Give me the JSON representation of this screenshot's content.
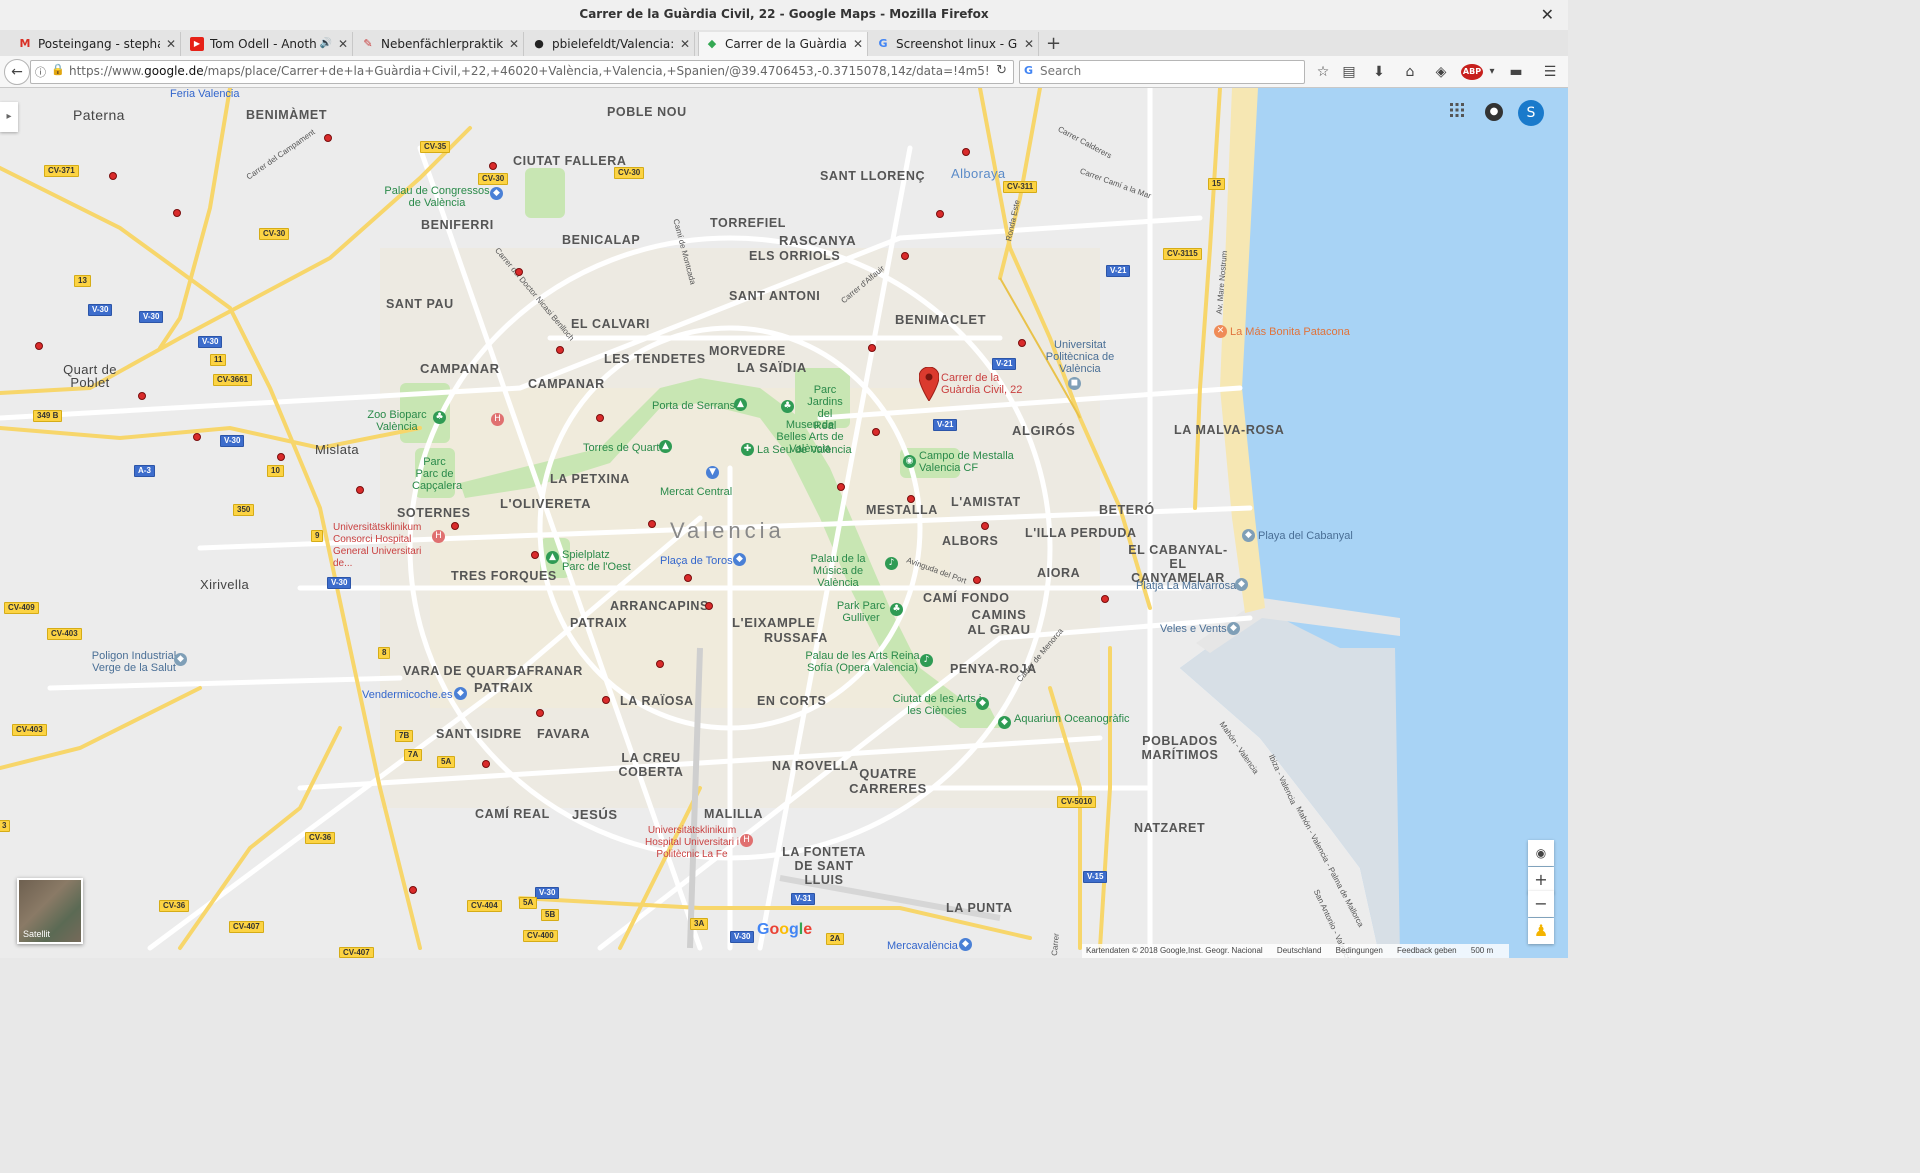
{
  "window": {
    "title": "Carrer de la Guàrdia Civil, 22 - Google Maps - Mozilla Firefox",
    "close_glyph": "✕"
  },
  "tabs": [
    {
      "label": "Posteingang - stepha...",
      "icon": "gmail-icon",
      "glyph": "M",
      "color": "#d93025",
      "close": "✕"
    },
    {
      "label": "Tom Odell - Anoth...",
      "icon": "youtube-icon",
      "glyph": "▶",
      "color": "#e62117",
      "close": "✕",
      "audio": "🔊"
    },
    {
      "label": "Nebenfächlerpraktiku...",
      "icon": "feather-icon",
      "glyph": "✎",
      "color": "#c94040",
      "close": "✕"
    },
    {
      "label": "pbielefeldt/Valencia: ...",
      "icon": "github-icon",
      "glyph": "●",
      "color": "#222222",
      "close": "✕"
    },
    {
      "label": "Carrer de la Guàrdia C...",
      "icon": "google-maps-icon",
      "glyph": "◆",
      "color": "#34a853",
      "close": "✕",
      "active": true
    },
    {
      "label": "Screenshot linux - Go...",
      "icon": "google-icon",
      "glyph": "G",
      "color": "#4285f4",
      "close": "✕"
    }
  ],
  "newtab": "+",
  "nav": {
    "back": "←",
    "url_prefix": "https://www.",
    "url_host": "google.de",
    "url_rest": "/maps/place/Carrer+de+la+Guàrdia+Civil,+22,+46020+València,+Valencia,+Spanien/@39.4706453,-0.3715078,14z/data=!4m5!3m4!1s0xd6048a1ffa",
    "reload": "↻",
    "search_placeholder": "Search",
    "toolbar": [
      "☆",
      "▤",
      "⬇",
      "⌂",
      "◈",
      "ABP",
      "▾",
      "▬",
      "☰"
    ]
  },
  "map": {
    "sidebar_toggle": "▸",
    "apps": "⋮⋮⋮",
    "bell": "●",
    "avatar": "S",
    "controls": {
      "locate": "◉",
      "zoom_in": "+",
      "zoom_out": "−",
      "pegman": "♟"
    },
    "satellite_label": "Satellit",
    "google_letters": [
      "G",
      "o",
      "o",
      "g",
      "l",
      "e"
    ],
    "google_colors": [
      "#4285f4",
      "#ea4335",
      "#fbbc05",
      "#4285f4",
      "#34a853",
      "#ea4335"
    ],
    "footer": [
      "Kartendaten © 2018 Google,Inst. Geogr. Nacional",
      "Deutschland",
      "Bedingungen",
      "Feedback geben",
      "500 m"
    ],
    "selected_place": {
      "line1": "Carrer de la",
      "line2": "Guàrdia Civil, 22"
    },
    "city_name": "Valencia",
    "districts": [
      "Paterna",
      "BENIMÀMET",
      "POBLE NOU",
      "CIUTAT FALLERA",
      "SANT LLORENÇ",
      "Alboraya",
      "TORREFIEL",
      "RASCANYA",
      "ELS ORRIOLS",
      "BENIFERRI",
      "BENICALAP",
      "SANT PAU",
      "SANT ANTONI",
      "BENIMACLET",
      "EL CALVARI",
      "CAMPANAR",
      "LES TENDETES",
      "MORVEDRE",
      "LA SAÏDIA",
      "Quart de Poblet",
      "ALGIRÓS",
      "LA MALVA-ROSA",
      "Mislata",
      "LA PETXINA",
      "L'OLIVERETA",
      "MESTALLA",
      "L'AMISTAT",
      "BETERÓ",
      "SOTERNES",
      "ALBORS",
      "L'ILLA PERDUDA",
      "EL CABANYAL-EL CANYAMELAR",
      "TRES FORQUES",
      "AIORA",
      "Xirivella",
      "ARRANCAPINS",
      "CAMÍ FONDO",
      "PATRAIX",
      "L'EIXAMPLE",
      "RUSSAFA",
      "CAMINS AL GRAU",
      "VARA DE QUART",
      "SAFRANAR",
      "PATRAIX",
      "PENYA-ROJA",
      "LA RAÏOSA",
      "EN CORTS",
      "SANT ISIDRE",
      "FAVARA",
      "POBLADOS MARÍTIMOS",
      "LA CREU COBERTA",
      "NA ROVELLA",
      "QUATRE CARRERES",
      "CAMÍ REAL",
      "JESÚS",
      "MALILLA",
      "NATZARET",
      "LA FONTETA DE SANT LLUIS",
      "LA PUNTA"
    ],
    "pois": [
      "Feria Valencia",
      "Palau de Congressos de València",
      "Universitat Politècnica de València",
      "La Más Bonita Patacona",
      "Porta de Serrans",
      "Parc Jardins del Real",
      "Museu de Belles Arts de València",
      "Zoo Bioparc València",
      "Torres de Quart",
      "La Seu de València",
      "Campo de Mestalla Valencia CF",
      "Parc Parc de Capçalera",
      "Mercat Central",
      "Universitätsklinikum Consorci Hospital General Universitari de...",
      "Spielplatz Parc de l'Oest",
      "Plaça de Toros",
      "Palau de la Música de València",
      "Playa del Cabanyal",
      "Platja La Malvarrosa",
      "Park Parc Gulliver",
      "Veles e Vents",
      "Poligon Industrial Verge de la Salut",
      "Palau de les Arts Reina Sofía (Opera Valencia)",
      "Vendermicoche.es",
      "Ciutat de les Arts i les Ciències",
      "Aquarium Oceanogràfic",
      "Universitätsklinikum Hospital Universitari i Politècnic La Fe",
      "Mercavalència"
    ],
    "streets": [
      "Carrer del Campament",
      "Carrer del Doctor Nicasi Benlloch",
      "Camí de Montcada",
      "Carrer d'Alfauir",
      "Carrer Calderers",
      "Carrer Camí a la Mar",
      "Ronda Este",
      "Av. Mare Nostrum",
      "Avinguda del Port",
      "Carrer de Menorca",
      "Mahón - Valencia",
      "Ibiza - Valencia",
      "Mahón - Valencia - Palma de Mallorca",
      "San Antonio - Valencia",
      "Carrer"
    ],
    "road_shields": [
      {
        "t": "CV-371",
        "c": "y"
      },
      {
        "t": "CV-35",
        "c": "y"
      },
      {
        "t": "CV-30",
        "c": "y"
      },
      {
        "t": "CV-30",
        "c": "y"
      },
      {
        "t": "CV-30",
        "c": "y"
      },
      {
        "t": "CV-311",
        "c": "y"
      },
      {
        "t": "15",
        "c": "y"
      },
      {
        "t": "CV-3115",
        "c": "y"
      },
      {
        "t": "V-21",
        "c": "b"
      },
      {
        "t": "13",
        "c": "y"
      },
      {
        "t": "V-30",
        "c": "b"
      },
      {
        "t": "V-30",
        "c": "b"
      },
      {
        "t": "V-30",
        "c": "b"
      },
      {
        "t": "11",
        "c": "y"
      },
      {
        "t": "CV-3661",
        "c": "y"
      },
      {
        "t": "349 B",
        "c": "y"
      },
      {
        "t": "V-21",
        "c": "b"
      },
      {
        "t": "V-21",
        "c": "b"
      },
      {
        "t": "V-30",
        "c": "b"
      },
      {
        "t": "A-3",
        "c": "b"
      },
      {
        "t": "10",
        "c": "y"
      },
      {
        "t": "350",
        "c": "y"
      },
      {
        "t": "9",
        "c": "y"
      },
      {
        "t": "V-30",
        "c": "b"
      },
      {
        "t": "CV-409",
        "c": "y"
      },
      {
        "t": "CV-403",
        "c": "y"
      },
      {
        "t": "8",
        "c": "y"
      },
      {
        "t": "CV-403",
        "c": "y"
      },
      {
        "t": "7B",
        "c": "y"
      },
      {
        "t": "7A",
        "c": "y"
      },
      {
        "t": "5A",
        "c": "y"
      },
      {
        "t": "CV-5010",
        "c": "y"
      },
      {
        "t": "CV-36",
        "c": "y"
      },
      {
        "t": "V-15",
        "c": "b"
      },
      {
        "t": "V-30",
        "c": "b"
      },
      {
        "t": "5A",
        "c": "y"
      },
      {
        "t": "5B",
        "c": "y"
      },
      {
        "t": "CV-404",
        "c": "y"
      },
      {
        "t": "CV-36",
        "c": "y"
      },
      {
        "t": "V-31",
        "c": "b"
      },
      {
        "t": "CV-407",
        "c": "y"
      },
      {
        "t": "3A",
        "c": "y"
      },
      {
        "t": "2A",
        "c": "y"
      },
      {
        "t": "CV-400",
        "c": "y"
      },
      {
        "t": "V-30",
        "c": "b"
      },
      {
        "t": "CV-407",
        "c": "y"
      },
      {
        "t": "3",
        "c": "y"
      }
    ],
    "colors": {
      "land": "#ececec",
      "road": "#ffffff",
      "highway": "#f7d66b",
      "sea": "#a8d3f5",
      "park": "#c8e6b3",
      "urban": "#f3efe1",
      "pin": "#db3a2e"
    }
  }
}
